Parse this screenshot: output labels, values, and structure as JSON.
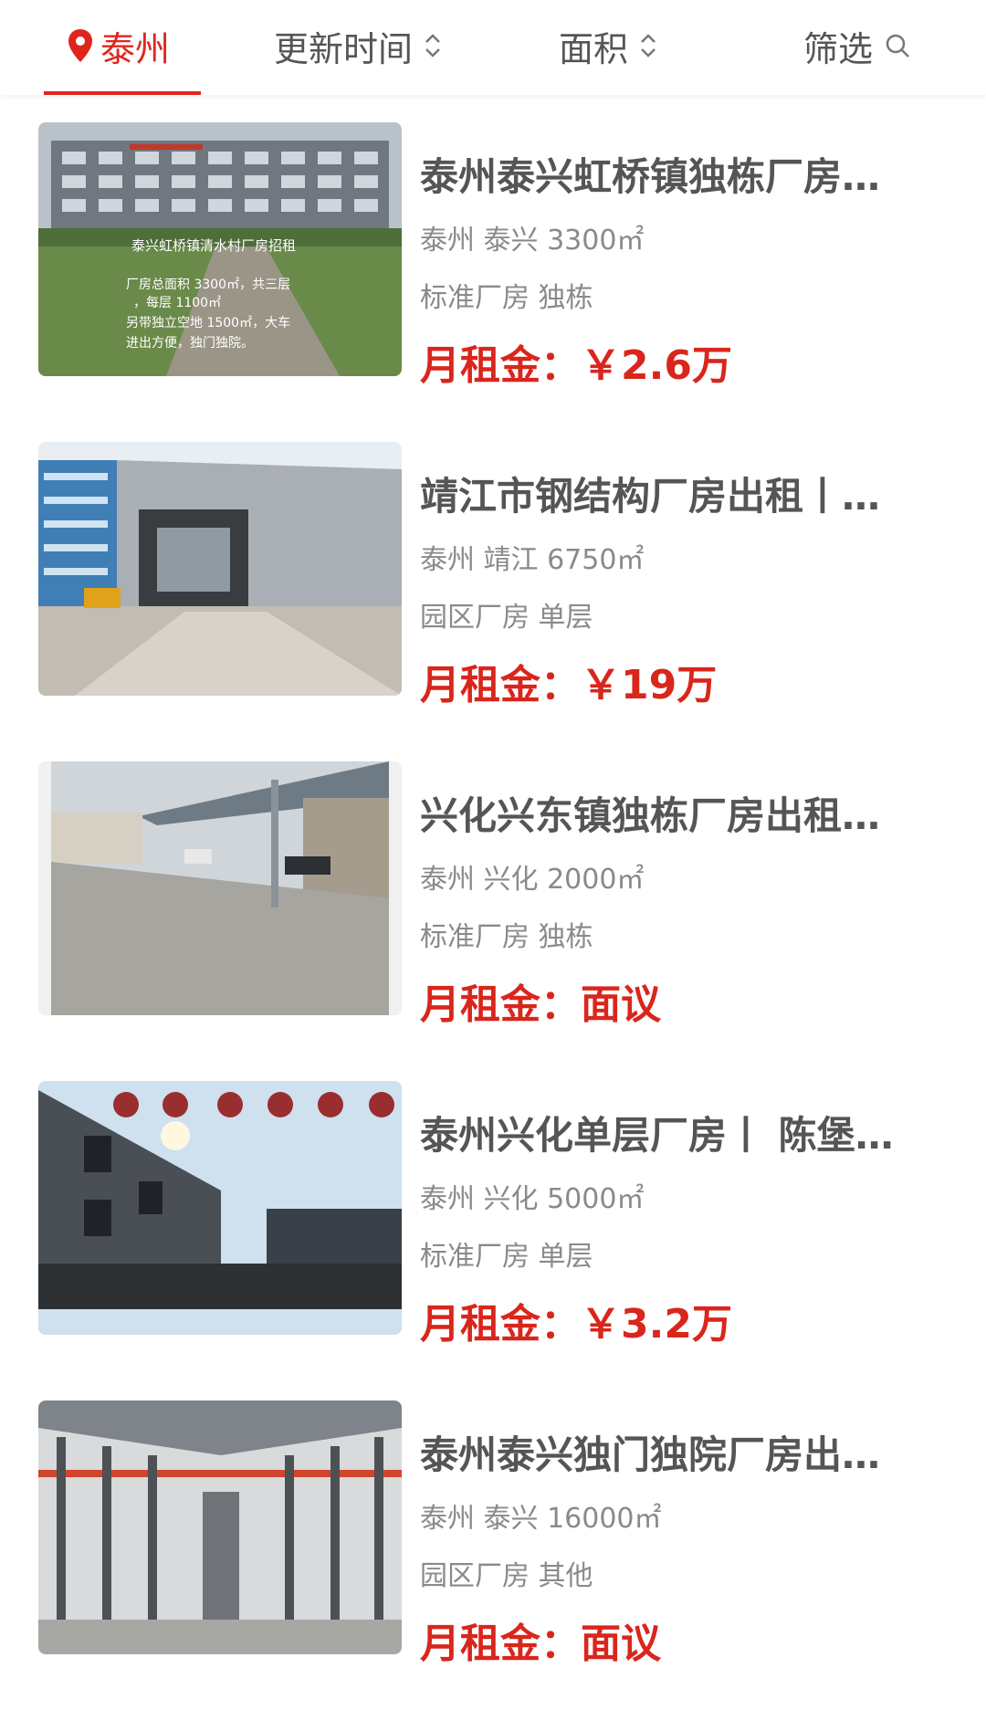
{
  "header": {
    "city": "泰州",
    "update_time": "更新时间",
    "area": "面积",
    "filter": "筛选"
  },
  "listings": [
    {
      "title": "泰州泰兴虹桥镇独栋厂房…",
      "location": "泰州 泰兴 3300㎡",
      "type": "标准厂房 独栋",
      "price": "月租金：￥2.6万",
      "image_text": [
        "泰兴虹桥镇清水村厂房招租",
        "厂房总面积 3300㎡，共三层",
        "，每层 1100㎡",
        "另带独立空地 1500㎡，大车",
        "进出方便，独门独院。"
      ]
    },
    {
      "title": "靖江市钢结构厂房出租丨…",
      "location": "泰州 靖江 6750㎡",
      "type": "园区厂房 单层",
      "price": "月租金：￥19万"
    },
    {
      "title": "兴化兴东镇独栋厂房出租…",
      "location": "泰州 兴化 2000㎡",
      "type": "标准厂房 独栋",
      "price": "月租金：面议"
    },
    {
      "title": "泰州兴化单层厂房丨 陈堡…",
      "location": "泰州 兴化 5000㎡",
      "type": "标准厂房 单层",
      "price": "月租金：￥3.2万"
    },
    {
      "title": "泰州泰兴独门独院厂房出…",
      "location": "泰州 泰兴 16000㎡",
      "type": "园区厂房 其他",
      "price": "月租金：面议"
    }
  ],
  "colors": {
    "accent": "#e0251d",
    "price": "#d9261c",
    "text": "#555555",
    "meta": "#8a8a8a"
  }
}
